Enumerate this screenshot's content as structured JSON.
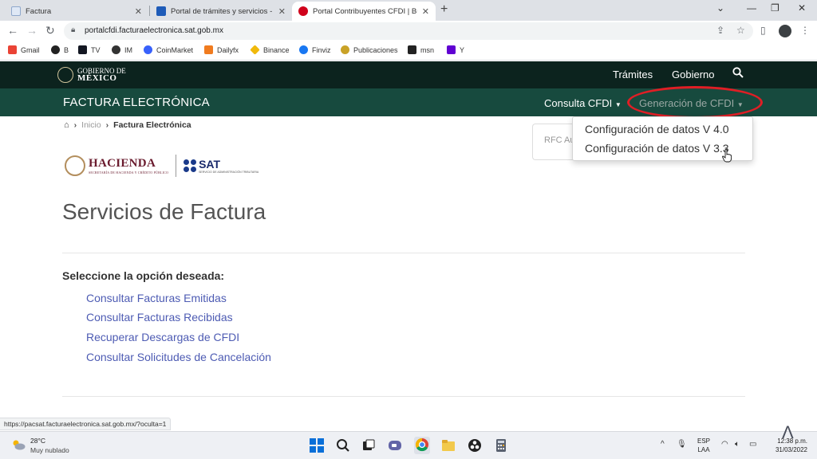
{
  "browser": {
    "tabs": [
      {
        "title": "Factura",
        "favicon": "document-icon",
        "active": false
      },
      {
        "title": "Portal de trámites y servicios - SAT",
        "favicon": "sat-icon",
        "active": false
      },
      {
        "title": "Portal Contribuyentes CFDI | Bus",
        "favicon": "red-dot-icon",
        "active": true
      }
    ],
    "new_tab": "+",
    "url": "portalcfdi.facturaelectronica.sat.gob.mx",
    "bookmarks": [
      {
        "label": "Gmail",
        "color": "#ea4335"
      },
      {
        "label": "B",
        "color": "#222222"
      },
      {
        "label": "TV",
        "color": "#131722"
      },
      {
        "label": "IM",
        "color": "#333333"
      },
      {
        "label": "CoinMarket",
        "color": "#3861fb"
      },
      {
        "label": "Dailyfx",
        "color": "#f07b1f"
      },
      {
        "label": "Binance",
        "color": "#f0b90b"
      },
      {
        "label": "Finviz",
        "color": "#1877f2"
      },
      {
        "label": "Publicaciones",
        "color": "#c9a227"
      },
      {
        "label": "msn",
        "color": "#222222"
      },
      {
        "label": "Y",
        "color": "#6001d2"
      }
    ],
    "status_url": "https://pacsat.facturaelectronica.sat.gob.mx/?oculta=1"
  },
  "gob_header": {
    "logo_line1": "GOBIERNO DE",
    "logo_line2": "MÉXICO",
    "nav": [
      "Trámites",
      "Gobierno"
    ]
  },
  "fe_header": {
    "title": "FACTURA ELECTRÓNICA",
    "consulta": "Consulta CFDI",
    "generacion": "Generación de CFDI"
  },
  "dropdown": {
    "items": [
      "Configuración de datos V 4.0",
      "Configuración de datos V 3.3"
    ]
  },
  "breadcrumb": {
    "home": "Inicio",
    "current": "Factura Electrónica"
  },
  "rfc_placeholder": "RFC Au",
  "logos": {
    "hacienda": "HACIENDA",
    "hacienda_sub": "SECRETARÍA DE HACIENDA Y CRÉDITO PÚBLICO",
    "sat": "SAT",
    "sat_sub": "SERVICIO DE ADMINISTRACIÓN TRIBUTARIA"
  },
  "main": {
    "heading": "Servicios de Factura",
    "prompt": "Seleccione la opción deseada:",
    "links": [
      "Consultar Facturas Emitidas",
      "Consultar Facturas Recibidas",
      "Recuperar Descargas de CFDI",
      "Consultar Solicitudes de Cancelación"
    ]
  },
  "taskbar": {
    "temp": "28°C",
    "weather": "Muy nublado",
    "lang1": "ESP",
    "lang2": "LAA",
    "time": "12:38 p.m.",
    "date": "31/03/2022"
  },
  "colors": {
    "gob_dark": "#0c231e",
    "fe_green": "#174a3e",
    "link": "#4d5bb3",
    "highlight": "#e01e25"
  }
}
